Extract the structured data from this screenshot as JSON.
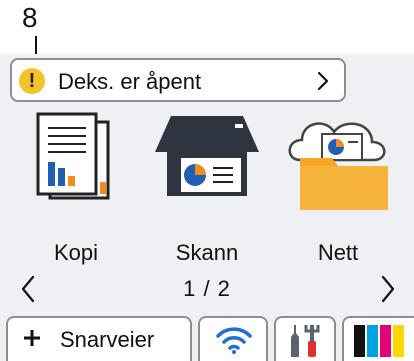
{
  "callout": {
    "number": "8"
  },
  "status": {
    "message": "Deks. er åpent",
    "level_color": "#f4c22b"
  },
  "tiles": [
    {
      "label": "Kopi",
      "icon": "copy-document-chart-icon"
    },
    {
      "label": "Skann",
      "icon": "scanner-icon"
    },
    {
      "label": "Nett",
      "icon": "cloud-web-folder-icon"
    }
  ],
  "pager": {
    "indicator": "1 / 2"
  },
  "bottom_bar": {
    "shortcuts_label": "Snarveier",
    "wifi_icon": "wifi-icon",
    "tools_icon": "settings-tools-icon",
    "toner_icon": "toner-icon",
    "toner_colors": [
      "#111111",
      "#00a3e0",
      "#e0007a",
      "#ffd600"
    ]
  }
}
